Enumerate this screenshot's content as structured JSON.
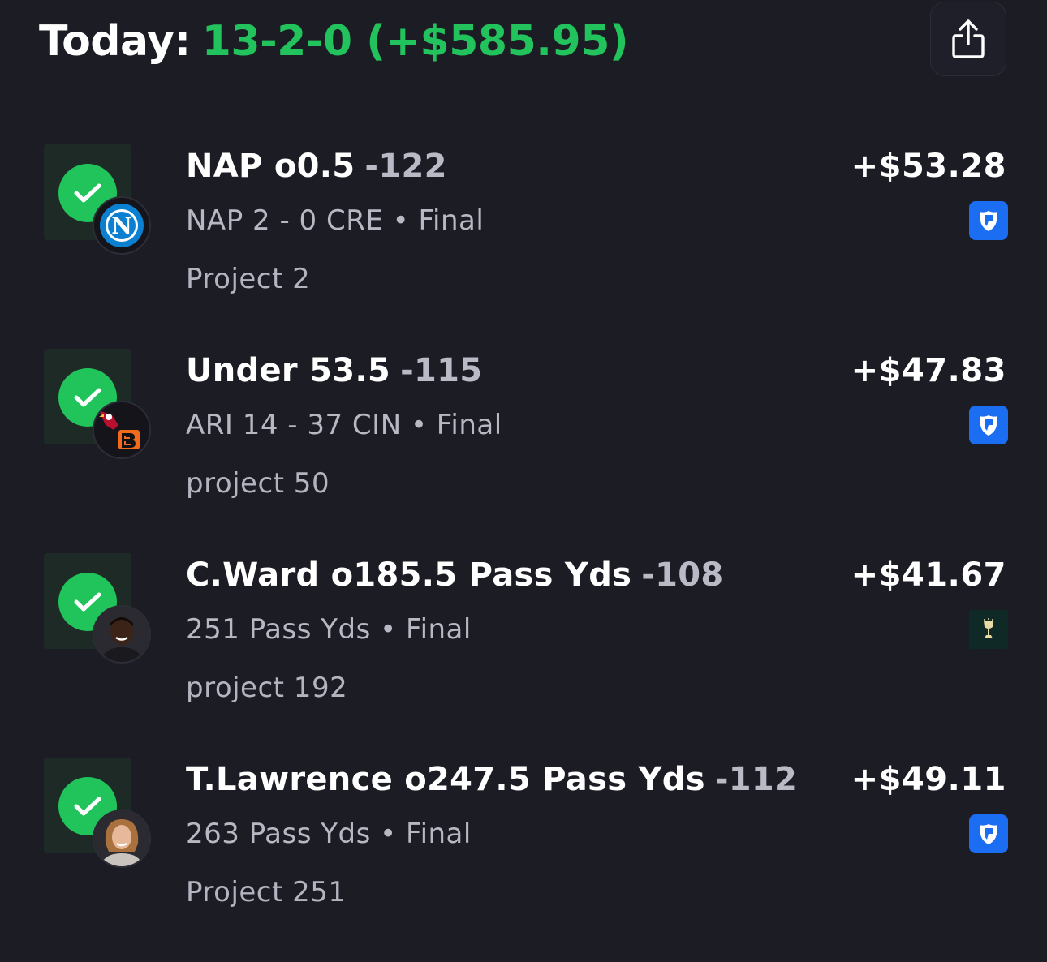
{
  "header": {
    "label": "Today:",
    "record": "13-2-0 (+$585.95)",
    "share_icon": "share-icon"
  },
  "colors": {
    "background": "#1c1c24",
    "win_green": "#20c45b",
    "odds_gray": "#b9bac6",
    "fanduel_blue": "#1b6df2"
  },
  "bets": [
    {
      "title": "NAP o0.5",
      "odds": "-122",
      "result": "NAP 2 - 0 CRE • Final",
      "note": "Project 2",
      "payout": "+$53.28",
      "status_icon": "check-icon",
      "badge_icon": "napoli-logo-icon",
      "book_icon": "fanduel-icon"
    },
    {
      "title": "Under 53.5",
      "odds": "-115",
      "result": "ARI 14 - 37 CIN • Final",
      "note": "project 50",
      "payout": "+$47.83",
      "status_icon": "check-icon",
      "badge_icon": "cardinals-bengals-logo-icon",
      "book_icon": "fanduel-icon"
    },
    {
      "title": "C.Ward o185.5 Pass Yds",
      "odds": "-108",
      "result": "251 Pass Yds • Final",
      "note": "project 192",
      "payout": "+$41.67",
      "status_icon": "check-icon",
      "badge_icon": "player-avatar-icon",
      "book_icon": "goblet-sportsbook-icon"
    },
    {
      "title": "T.Lawrence o247.5 Pass Yds",
      "odds": "-112",
      "result": "263 Pass Yds • Final",
      "note": "Project 251",
      "payout": "+$49.11",
      "status_icon": "check-icon",
      "badge_icon": "player-avatar-icon",
      "book_icon": "fanduel-icon"
    }
  ]
}
